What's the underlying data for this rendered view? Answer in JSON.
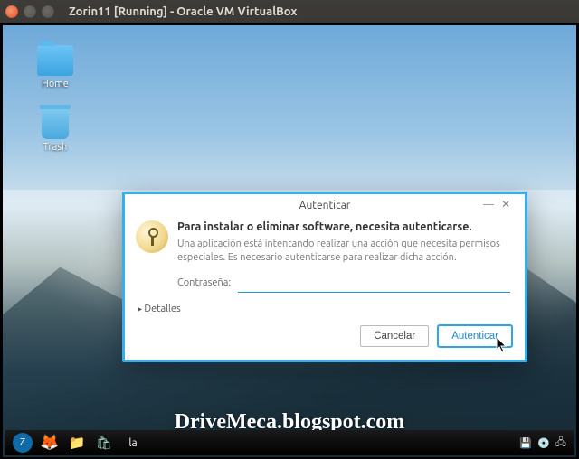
{
  "host_titlebar": {
    "title": "Zorin11 [Running] - Oracle VM VirtualBox"
  },
  "desktop": {
    "icons": [
      {
        "label": "Home"
      },
      {
        "label": "Trash"
      }
    ]
  },
  "dialog": {
    "title": "Autenticar",
    "heading": "Para instalar o eliminar software, necesita autenticarse.",
    "message": "Una aplicación está intentando realizar una acción que necesita permisos especiales. Es necesario autenticarse para realizar dicha acción.",
    "password_label": "Contraseña:",
    "password_value": "",
    "details_label": "Detalles",
    "cancel_label": "Cancelar",
    "confirm_label": "Autenticar"
  },
  "watermark": "DriveMeca.blogspot.com",
  "taskbar": {
    "keyboard_indicator": "la"
  }
}
